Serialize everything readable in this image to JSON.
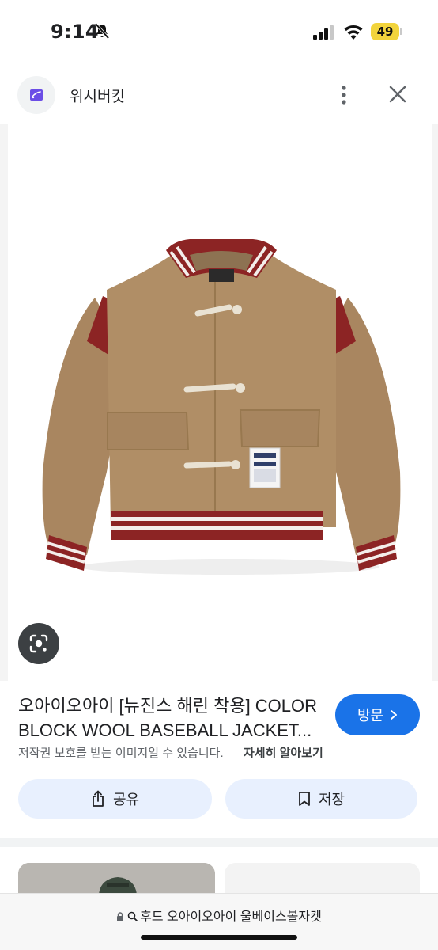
{
  "status_bar": {
    "time": "9:14",
    "battery_level": "49",
    "battery_color": "#f2d43c"
  },
  "header": {
    "site_name": "위시버킷",
    "logo_icon": "wishbucket-logo-icon",
    "more_icon": "more-vert-icon",
    "close_icon": "close-icon"
  },
  "image": {
    "lens_icon": "lens-search-icon"
  },
  "result": {
    "title_line1": "오아이오아이 [뉴진스 해린 착용] COLOR",
    "title_line2": "BLOCK WOOL BASEBALL JACKET...",
    "visit_label": "방문",
    "copyright_notice": "저작권 보호를 받는 이미지일 수 있습니다.",
    "learn_more": "자세히 알아보기",
    "share_label": "공유",
    "save_label": "저장"
  },
  "url_bar": {
    "text": "후드 오아이오아이 울베이스볼자켓"
  },
  "colors": {
    "accent": "#1a73e8",
    "chip_bg": "#e8f0fe"
  }
}
